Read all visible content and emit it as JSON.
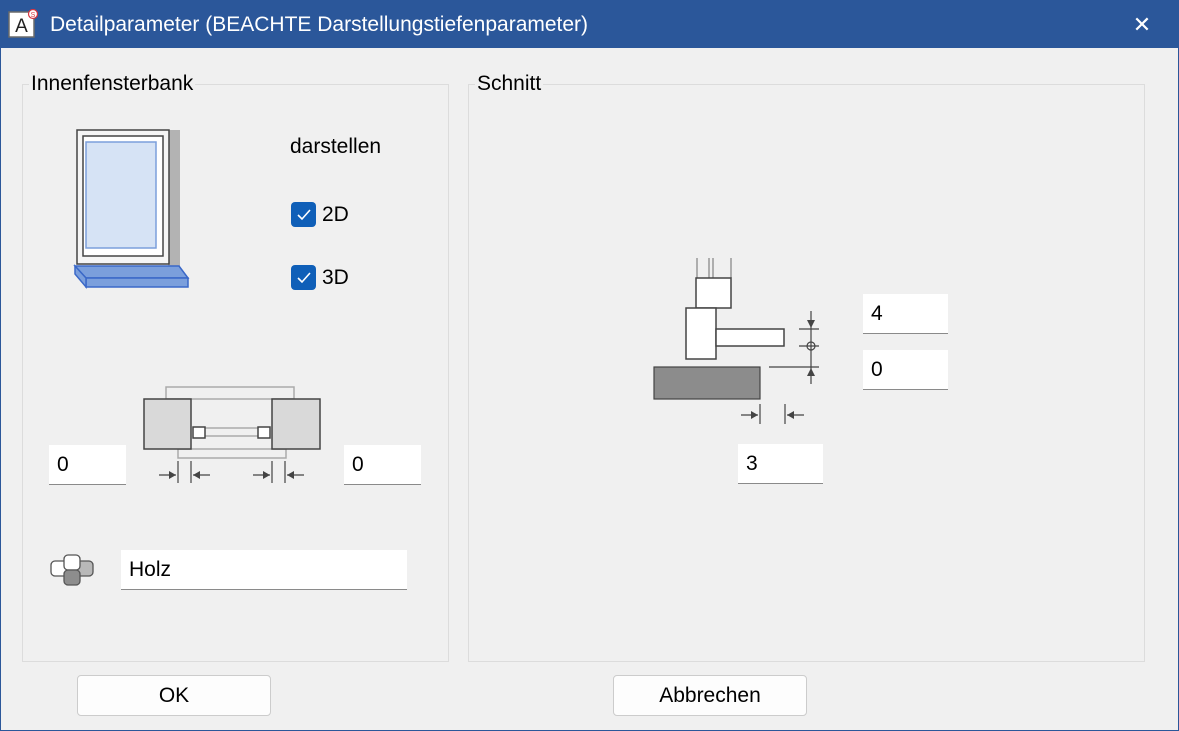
{
  "window": {
    "title": "Detailparameter (BEACHTE Darstellungstiefenparameter)",
    "app_icon_letter": "A",
    "close_glyph": "✕",
    "titlebar_color": "#2b579a"
  },
  "inner_sill": {
    "group_label": "Innenfensterbank",
    "show_label": "darstellen",
    "cb_2d": {
      "label": "2D",
      "checked": true
    },
    "cb_3d": {
      "label": "3D",
      "checked": true
    },
    "left_value": "0",
    "right_value": "0",
    "material_icon": "material-icon",
    "material_value": "Holz"
  },
  "section": {
    "group_label": "Schnitt",
    "top_value": "4",
    "middle_value": "0",
    "bottom_value": "3"
  },
  "buttons": {
    "ok": "OK",
    "cancel": "Abbrechen"
  },
  "colors": {
    "checkbox": "#0f5fb8",
    "sill_blue": "#7b9fdc",
    "glass": "#d6e3f5"
  }
}
